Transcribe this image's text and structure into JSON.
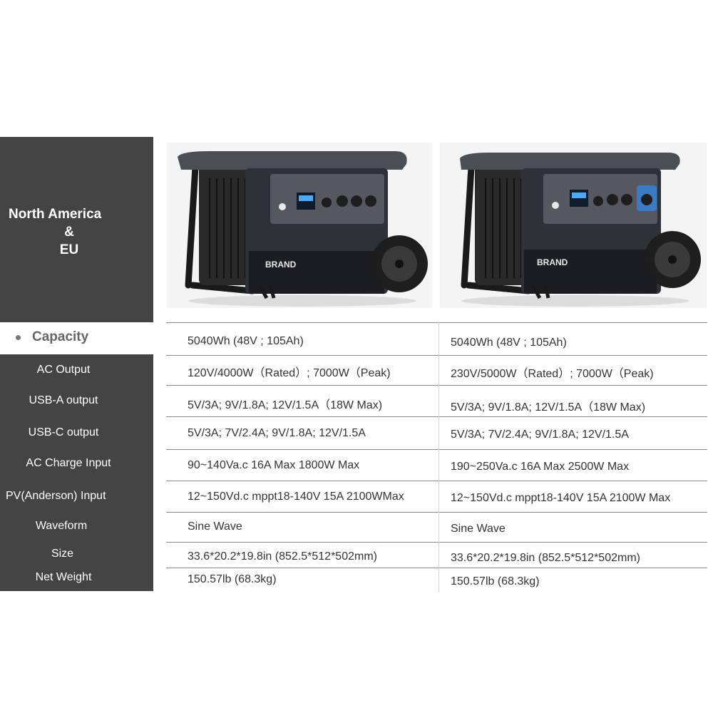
{
  "region": {
    "line1": "North America",
    "line2": "&",
    "line3": "EU"
  },
  "capacity_label": "Capacity",
  "spec_labels": [
    "AC Output",
    "USB-A output",
    "USB-C output",
    "AC Charge Input",
    "PV(Anderson) Input",
    "Waveform",
    "Size",
    "Net Weight"
  ],
  "products": [
    {
      "brand": "BRAND",
      "socket_style": "north-america"
    },
    {
      "brand": "BRAND",
      "socket_style": "eu"
    }
  ],
  "north_america": {
    "capacity": "5040Wh (48V ; 105Ah)",
    "ac_output": "120V/4000W（Rated）; 7000W（Peak)",
    "usb_a": "5V/3A; 9V/1.8A; 12V/1.5A（18W Max)",
    "usb_c": "5V/3A; 7V/2.4A; 9V/1.8A; 12V/1.5A",
    "ac_charge": "90~140Va.c  16A Max   1800W  Max",
    "pv_input": "12~150Vd.c mppt18-140V 15A  2100WMax",
    "waveform": "Sine Wave",
    "size": "33.6*20.2*19.8in (852.5*512*502mm)",
    "net_weight": "150.57lb (68.3kg)"
  },
  "eu": {
    "capacity": "5040Wh (48V ; 105Ah)",
    "ac_output": "230V/5000W（Rated）; 7000W（Peak)",
    "usb_a": "5V/3A; 9V/1.8A; 12V/1.5A（18W Max)",
    "usb_c": "5V/3A; 7V/2.4A; 9V/1.8A; 12V/1.5A",
    "ac_charge": "190~250Va.c  16A Max   2500W  Max",
    "pv_input": "12~150Vd.c mppt18-140V 15A 2100W Max",
    "waveform": "Sine Wave",
    "size": "33.6*20.2*19.8in (852.5*512*502mm)",
    "net_weight": "150.57lb (68.3kg)"
  },
  "colors": {
    "panel": "#444444",
    "text": "#333333",
    "eu_socket": "#3a7bc8"
  }
}
